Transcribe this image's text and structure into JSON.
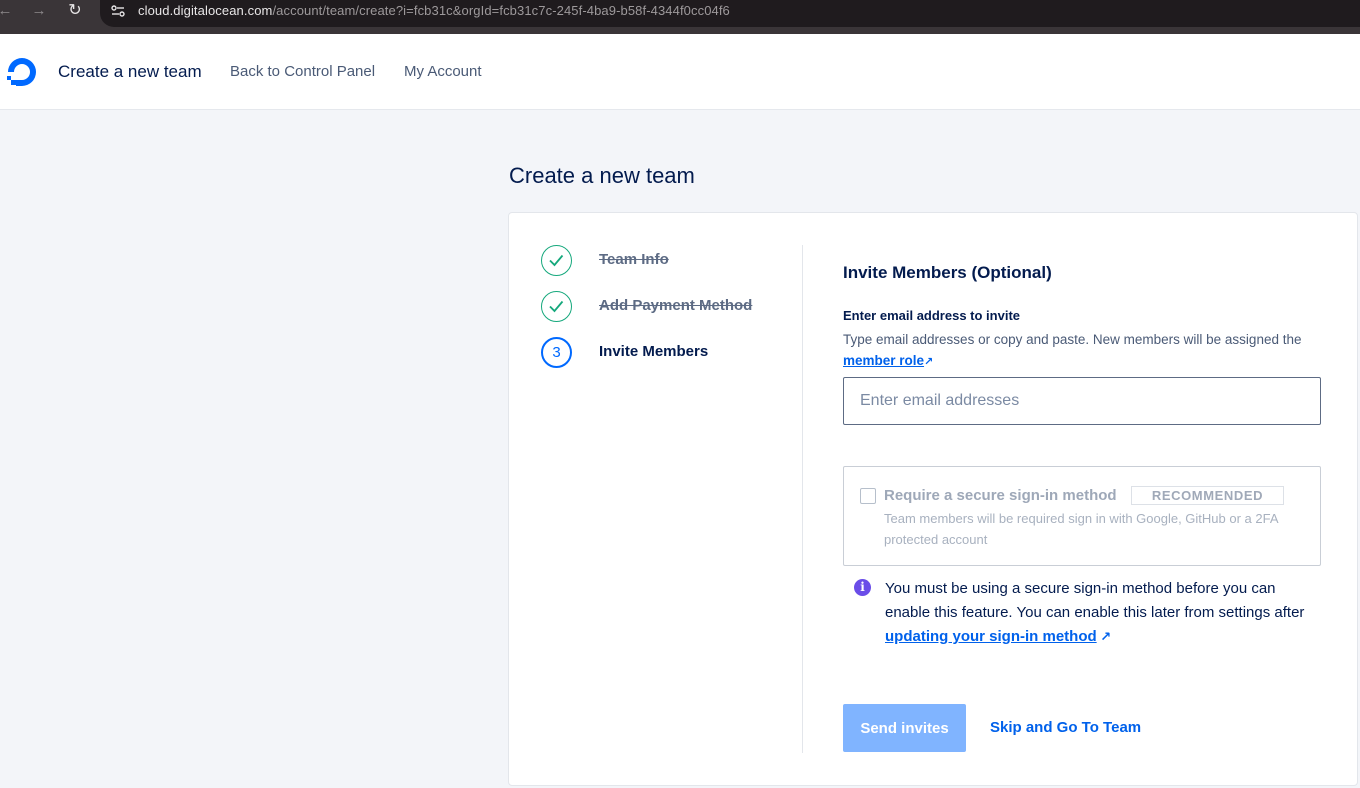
{
  "browser": {
    "url_host": "cloud.digitalocean.com",
    "url_path": "/account/team/create?i=fcb31c&orgId=fcb31c7c-245f-4ba9-b58f-4344f0cc04f6",
    "back_icon": "arrow-left-icon",
    "forward_icon": "arrow-right-icon",
    "reload_icon": "reload-icon",
    "site_info_icon": "site-settings-icon"
  },
  "header": {
    "title": "Create a new team",
    "links": [
      "Back to Control Panel",
      "My Account"
    ],
    "logo_icon": "digitalocean-logo-icon"
  },
  "page": {
    "title": "Create a new team"
  },
  "steps": [
    {
      "label": "Team Info",
      "status": "done"
    },
    {
      "label": "Add Payment Method",
      "status": "done"
    },
    {
      "number": "3",
      "label": "Invite Members",
      "status": "active"
    }
  ],
  "invite": {
    "section_title": "Invite Members (Optional)",
    "field_label": "Enter email address to invite",
    "help_text": "Type email addresses or copy and paste. New members will be assigned the",
    "help_link": "member role",
    "email_placeholder": "Enter email addresses",
    "email_value": ""
  },
  "secure": {
    "label": "Require a secure sign-in method",
    "badge": "RECOMMENDED",
    "description": "Team members will be required sign in with Google, GitHub or a 2FA protected account",
    "checked": false
  },
  "notice": {
    "icon": "info-icon",
    "text": "You must be using a secure sign-in method before you can enable this feature. You can enable this later from settings after",
    "link": "updating your sign-in method"
  },
  "actions": {
    "send_label": "Send invites",
    "skip_label": "Skip and Go To Team"
  },
  "colors": {
    "brand": "#0069ff",
    "success": "#15a87c",
    "info": "#6a4de8",
    "button_disabled": "#80b4ff"
  }
}
